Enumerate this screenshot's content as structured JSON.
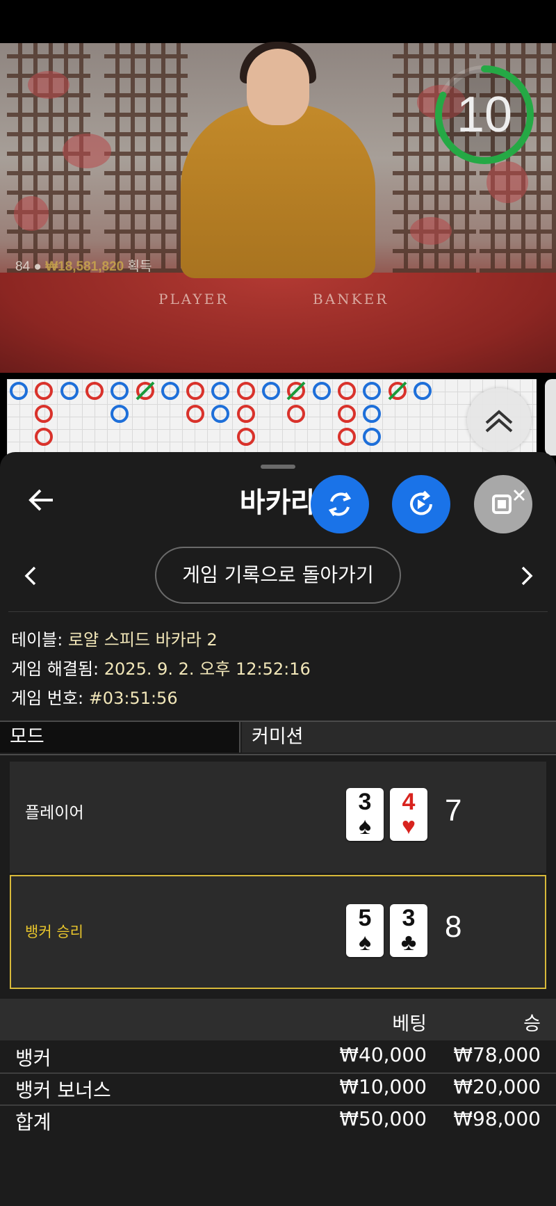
{
  "video": {
    "countdown": "10",
    "countdown_progress": 0.82,
    "viewers": "84",
    "total_amount": "₩18,581,820",
    "total_suffix": "획득",
    "felt_player": "PLAYER",
    "felt_banker": "BANKER"
  },
  "road": {
    "row1": [
      "b",
      "r",
      "b",
      "r",
      "b",
      "r",
      "b",
      "r",
      "b",
      "r",
      "b",
      "r",
      "b",
      "r",
      "b",
      "r",
      "b"
    ],
    "row2": [
      null,
      "r",
      null,
      null,
      "b",
      null,
      null,
      "r",
      "b",
      "r",
      null,
      "r",
      null,
      "r",
      "b",
      null,
      null
    ],
    "row3": [
      null,
      "r",
      null,
      null,
      null,
      null,
      null,
      null,
      null,
      "r",
      null,
      null,
      null,
      "r",
      "b",
      null,
      null
    ],
    "ties_at": [
      5,
      11,
      15
    ]
  },
  "panel": {
    "title": "바카라",
    "back_icon": "arrow-left-icon",
    "history_button": "게임 기록으로 돌아가기",
    "table_label": "테이블:",
    "table_value": "로얄 스피드 바카라 2",
    "resolved_label": "게임 해결됨:",
    "resolved_value": "2025. 9. 2. 오후 12:52:16",
    "game_no_label": "게임 번호:",
    "game_no_value": "#03:51:56",
    "tab_mode": "모드",
    "tab_commission": "커미션"
  },
  "result": {
    "player": {
      "label": "플레이어",
      "cards": [
        {
          "rank": "3",
          "suit": "♠",
          "color": "black"
        },
        {
          "rank": "4",
          "suit": "♥",
          "color": "red"
        }
      ],
      "score": "7"
    },
    "banker": {
      "label": "뱅커 승리",
      "cards": [
        {
          "rank": "5",
          "suit": "♠",
          "color": "black"
        },
        {
          "rank": "3",
          "suit": "♣",
          "color": "black"
        }
      ],
      "score": "8"
    }
  },
  "bets": {
    "col_bet": "베팅",
    "col_win": "승",
    "rows": [
      {
        "name": "뱅커",
        "bet": "₩40,000",
        "win": "₩78,000"
      },
      {
        "name": "뱅커 보너스",
        "bet": "₩10,000",
        "win": "₩20,000"
      },
      {
        "name": "합계",
        "bet": "₩50,000",
        "win": "₩98,000"
      }
    ]
  },
  "colors": {
    "accent_blue": "#1a73e8",
    "banker_gold": "#d8b93a",
    "value_cream": "#f1e6b8"
  }
}
